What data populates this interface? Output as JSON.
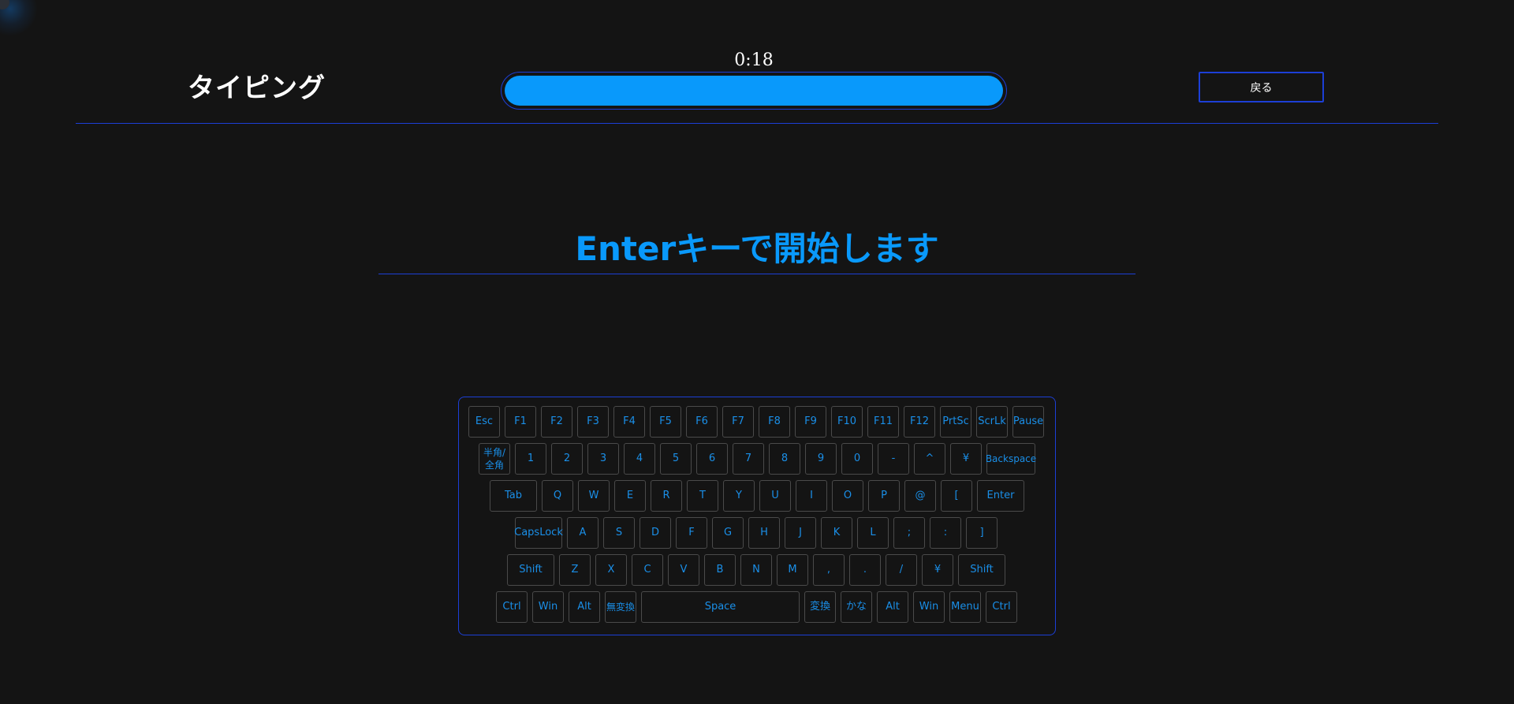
{
  "header": {
    "title": "タイピング",
    "timer": "0:18",
    "progress_fraction": 1.0,
    "back_label": "戻る"
  },
  "main": {
    "start_message": "Enterキーで開始します"
  },
  "keyboard": {
    "rows": [
      [
        "Esc",
        "F1",
        "F2",
        "F3",
        "F4",
        "F5",
        "F6",
        "F7",
        "F8",
        "F9",
        "F10",
        "F11",
        "F12",
        "PrtSc",
        "ScrLk",
        "Pause"
      ],
      [
        "半角/\n全角",
        "1",
        "2",
        "3",
        "4",
        "5",
        "6",
        "7",
        "8",
        "9",
        "0",
        "-",
        "^",
        "¥",
        "Backspace"
      ],
      [
        "Tab",
        "Q",
        "W",
        "E",
        "R",
        "T",
        "Y",
        "U",
        "I",
        "O",
        "P",
        "@",
        "[",
        "Enter"
      ],
      [
        "CapsLock",
        "A",
        "S",
        "D",
        "F",
        "G",
        "H",
        "J",
        "K",
        "L",
        ";",
        ":",
        "]"
      ],
      [
        "Shift",
        "Z",
        "X",
        "C",
        "V",
        "B",
        "N",
        "M",
        ",",
        ".",
        "/",
        "¥",
        "Shift"
      ],
      [
        "Ctrl",
        "Win",
        "Alt",
        "無変換",
        "Space",
        "変換",
        "かな",
        "Alt",
        "Win",
        "Menu",
        "Ctrl"
      ]
    ]
  },
  "colors": {
    "background": "#141414",
    "accent": "#0999fb",
    "border": "#1c3fd6",
    "key_text": "#1a8fe8"
  }
}
